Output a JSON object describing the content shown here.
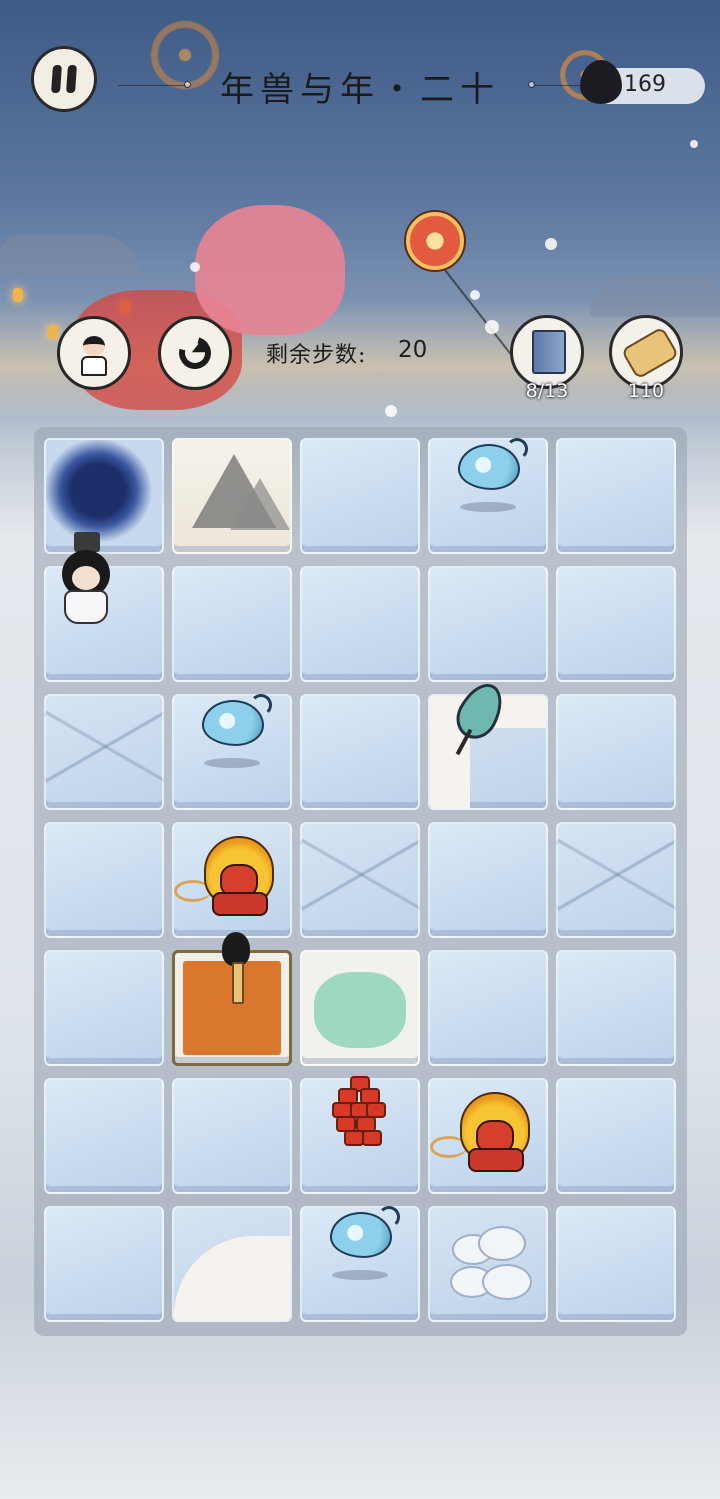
{
  "header": {
    "level_title": "年兽与年・二十",
    "ink_count": "169"
  },
  "controls": {
    "steps_label": "剩余步数:",
    "steps_remaining": "20",
    "collection_progress": "8/13",
    "scroll_count": "110"
  },
  "board": {
    "columns": 5,
    "rows": 7,
    "tiles": [
      [
        "hole",
        "mountain",
        "ice",
        "ice",
        "ice"
      ],
      [
        "ice",
        "ice",
        "ice",
        "ice",
        "ice"
      ],
      [
        "cracked",
        "ice",
        "ice",
        "path",
        "ice"
      ],
      [
        "ice",
        "ice",
        "cracked",
        "ice",
        "cracked"
      ],
      [
        "ice",
        "stove",
        "pond",
        "ice",
        "ice"
      ],
      [
        "ice",
        "ice",
        "ice",
        "ice",
        "ice"
      ],
      [
        "ice",
        "path",
        "ice",
        "cloud",
        "ice"
      ]
    ],
    "pieces": [
      {
        "type": "hero",
        "row": 1,
        "col": 0
      },
      {
        "type": "spirit",
        "row": 0,
        "col": 3
      },
      {
        "type": "spirit",
        "row": 2,
        "col": 1
      },
      {
        "type": "spirit",
        "row": 6,
        "col": 2
      },
      {
        "type": "nian-beast",
        "row": 3,
        "col": 1
      },
      {
        "type": "nian-beast",
        "row": 5,
        "col": 3
      },
      {
        "type": "fan",
        "row": 2,
        "col": 3
      },
      {
        "type": "firecracker",
        "row": 5,
        "col": 2
      },
      {
        "type": "torch",
        "row": 4,
        "col": 1
      }
    ]
  },
  "icons": {
    "pause": "pause-icon",
    "hint": "hint-character-icon",
    "undo": "undo-icon",
    "collection": "book-spirit-icon",
    "scroll": "scroll-icon",
    "ink": "ink-drop-icon"
  },
  "colors": {
    "sky_top": "#3d5a86",
    "tile_ice": "#c8dbef",
    "ink": "#1c1c22",
    "stove_rug": "#d9772e",
    "beast_mane": "#f7c433"
  }
}
